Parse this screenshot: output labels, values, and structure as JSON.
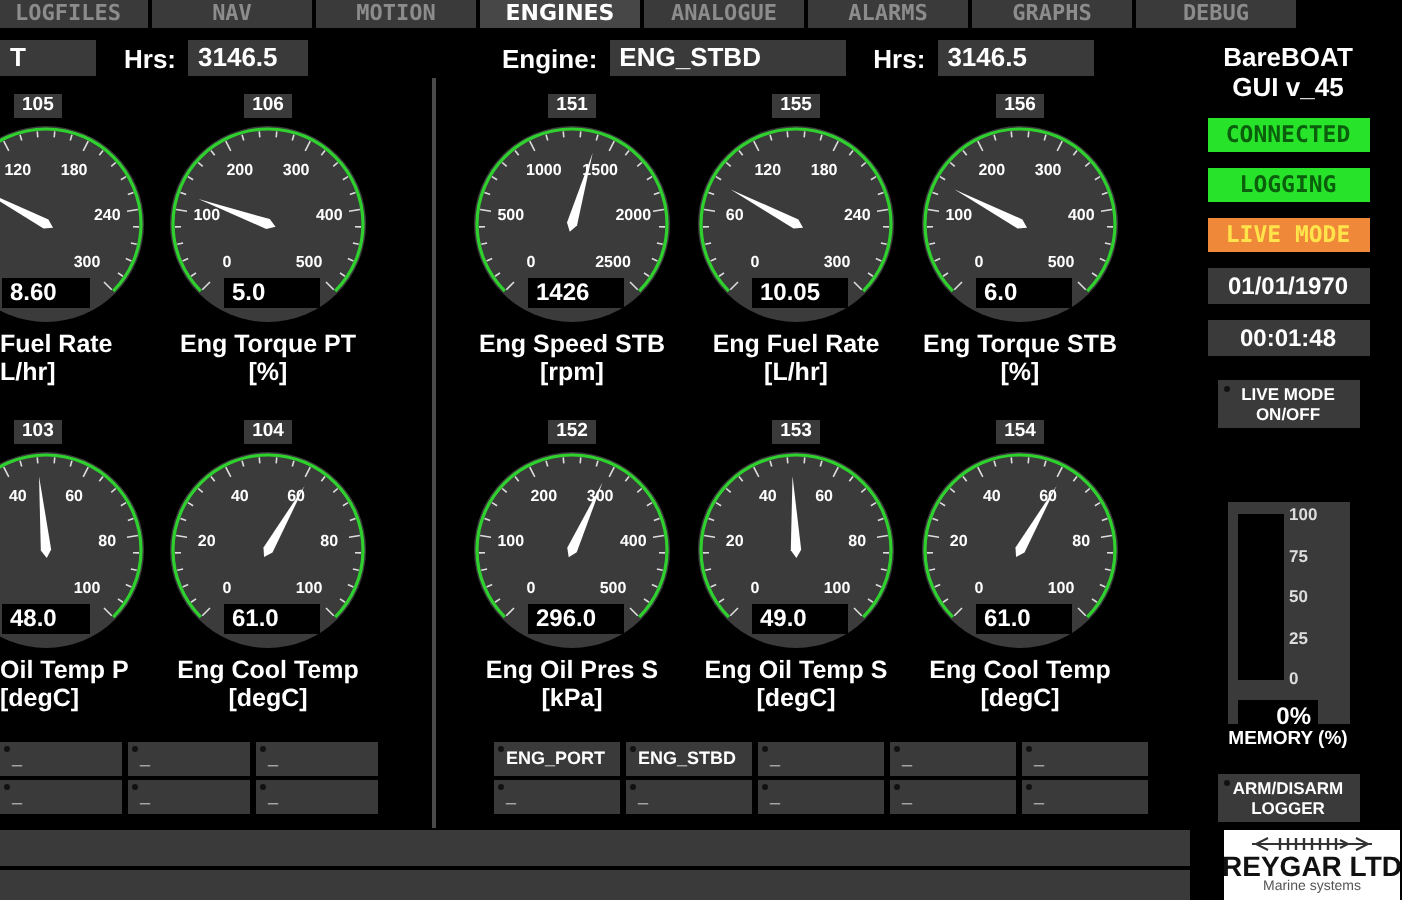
{
  "tabs": [
    {
      "label": "LOGFILES",
      "selected": false
    },
    {
      "label": "NAV",
      "selected": false
    },
    {
      "label": "MOTION",
      "selected": false
    },
    {
      "label": "ENGINES",
      "selected": true
    },
    {
      "label": "ANALOGUE",
      "selected": false
    },
    {
      "label": "ALARMS",
      "selected": false
    },
    {
      "label": "GRAPHS",
      "selected": false
    },
    {
      "label": "DEBUG",
      "selected": false
    }
  ],
  "engine_panels": [
    {
      "engine_field": "T",
      "hrs_label": "Hrs:",
      "hrs_value": "3146.5",
      "gauge_rows": [
        [
          {
            "kind": "cut",
            "id": "105",
            "scale": [
              "120",
              "180",
              "240",
              "300"
            ],
            "level": 0.27,
            "value": "8.60",
            "title": "Fuel Rate",
            "unit": "L/hr]"
          },
          {
            "kind": "full",
            "id": "106",
            "scale": [
              "0",
              "100",
              "200",
              "300",
              "400",
              "500"
            ],
            "level": 0.24,
            "value": "5.0",
            "title": "Eng Torque PT",
            "unit": "[%]"
          }
        ],
        [
          {
            "kind": "cut",
            "id": "103",
            "scale": [
              "40",
              "60",
              "80",
              "100"
            ],
            "level": 0.48,
            "value": "48.0",
            "title": "Oil Temp P",
            "unit": "[degC]"
          },
          {
            "kind": "full",
            "id": "104",
            "scale": [
              "0",
              "20",
              "40",
              "60",
              "80",
              "100"
            ],
            "level": 0.61,
            "value": "61.0",
            "title": "Eng Cool Temp",
            "unit": "[degC]"
          }
        ]
      ],
      "indicator_rows": [
        [
          "_",
          "_",
          "_"
        ],
        [
          "_",
          "_",
          "_"
        ]
      ]
    },
    {
      "engine_label": "Engine:",
      "engine_field": "ENG_STBD",
      "hrs_label": "Hrs:",
      "hrs_value": "3146.5",
      "gauge_rows": [
        [
          {
            "kind": "full",
            "id": "151",
            "scale": [
              "0",
              "500",
              "1000",
              "1500",
              "2000",
              "2500"
            ],
            "level": 0.56,
            "value": "1426",
            "title": "Eng Speed STB",
            "unit": "[rpm]"
          },
          {
            "kind": "full",
            "id": "155",
            "scale": [
              "0",
              "60",
              "120",
              "180",
              "240",
              "300"
            ],
            "level": 0.27,
            "value": "10.05",
            "title": "Eng Fuel Rate",
            "unit": "[L/hr]"
          },
          {
            "kind": "full",
            "id": "156",
            "scale": [
              "0",
              "100",
              "200",
              "300",
              "400",
              "500"
            ],
            "level": 0.27,
            "value": "6.0",
            "title": "Eng Torque STB",
            "unit": "[%]"
          }
        ],
        [
          {
            "kind": "full",
            "id": "152",
            "scale": [
              "0",
              "100",
              "200",
              "300",
              "400",
              "500"
            ],
            "level": 0.59,
            "value": "296.0",
            "title": "Eng Oil Pres S",
            "unit": "[kPa]"
          },
          {
            "kind": "full",
            "id": "153",
            "scale": [
              "0",
              "20",
              "40",
              "60",
              "80",
              "100"
            ],
            "level": 0.49,
            "value": "49.0",
            "title": "Eng Oil Temp S",
            "unit": "[degC]"
          },
          {
            "kind": "full",
            "id": "154",
            "scale": [
              "0",
              "20",
              "40",
              "60",
              "80",
              "100"
            ],
            "level": 0.61,
            "value": "61.0",
            "title": "Eng Cool Temp",
            "unit": "[degC]"
          }
        ]
      ],
      "indicator_rows": [
        [
          "ENG_PORT",
          "ENG_STBD",
          "_",
          "_",
          "_"
        ],
        [
          "_",
          "_",
          "_",
          "_",
          "_"
        ]
      ]
    }
  ],
  "sidebar": {
    "title": [
      "BareBOAT",
      "GUI v_45"
    ],
    "status": [
      {
        "label": "CONNECTED",
        "color": "#27e32a"
      },
      {
        "label": "LOGGING",
        "color": "#27e32a"
      },
      {
        "label": "LIVE MODE",
        "color": "#f0883a"
      }
    ],
    "date": "01/01/1970",
    "time": "00:01:48",
    "live_button": "LIVE MODE ON/OFF",
    "memory": {
      "scale": [
        "100",
        "75",
        "50",
        "25",
        "0"
      ],
      "level": 0,
      "reading": "0%",
      "label": "MEMORY (%)"
    },
    "arm_button": "ARM/DISARM LOGGER"
  },
  "logo": {
    "name": "REYGAR LTD",
    "tagline": "Marine systems"
  }
}
